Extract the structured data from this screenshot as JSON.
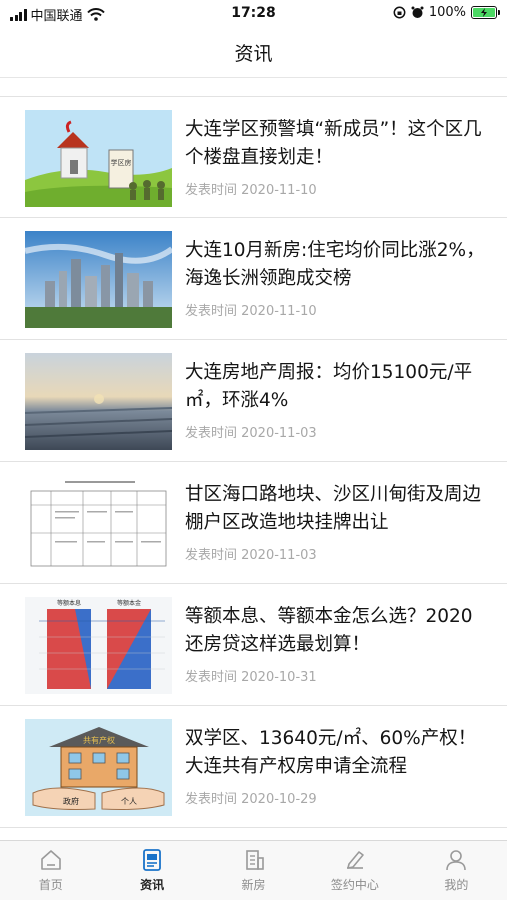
{
  "status_bar": {
    "carrier": "中国联通",
    "time": "17:28",
    "battery": "100%"
  },
  "header": {
    "title": "资讯"
  },
  "articles": [
    {
      "title": "大连学区预警填“新成员”！这个区几个楼盘直接划走！",
      "date": "发表时间 2020-11-10"
    },
    {
      "title": "大连10月新房:住宅均价同比涨2%，海逸长洲领跑成交榜",
      "date": "发表时间 2020-11-10"
    },
    {
      "title": "大连房地产周报：均价15100元/平㎡，环涨4%",
      "date": "发表时间 2020-11-03"
    },
    {
      "title": "甘区海口路地块、沙区川甸街及周边棚户区改造地块挂牌出让",
      "date": "发表时间 2020-11-03"
    },
    {
      "title": "等额本息、等额本金怎么选？2020还房贷这样选最划算！",
      "date": "发表时间 2020-10-31"
    },
    {
      "title": "双学区、13640元/㎡、60%产权！大连共有产权房申请全流程",
      "date": "发表时间 2020-10-29"
    }
  ],
  "thumb_text": {
    "house_sign": "学区房",
    "shared_house": "共有产权",
    "hand_left": "政府",
    "hand_right": "个人",
    "chart_left": "等额本息",
    "chart_right": "等额本金"
  },
  "tabs": [
    {
      "label": "首页",
      "icon": "home-icon"
    },
    {
      "label": "资讯",
      "icon": "news-icon"
    },
    {
      "label": "新房",
      "icon": "building-icon"
    },
    {
      "label": "签约中心",
      "icon": "sign-icon"
    },
    {
      "label": "我的",
      "icon": "user-icon"
    }
  ],
  "colors": {
    "accent": "#1a73c9",
    "loan_red": "#d94a4a",
    "loan_blue": "#3b6fc9",
    "battery_green": "#4cd964"
  }
}
